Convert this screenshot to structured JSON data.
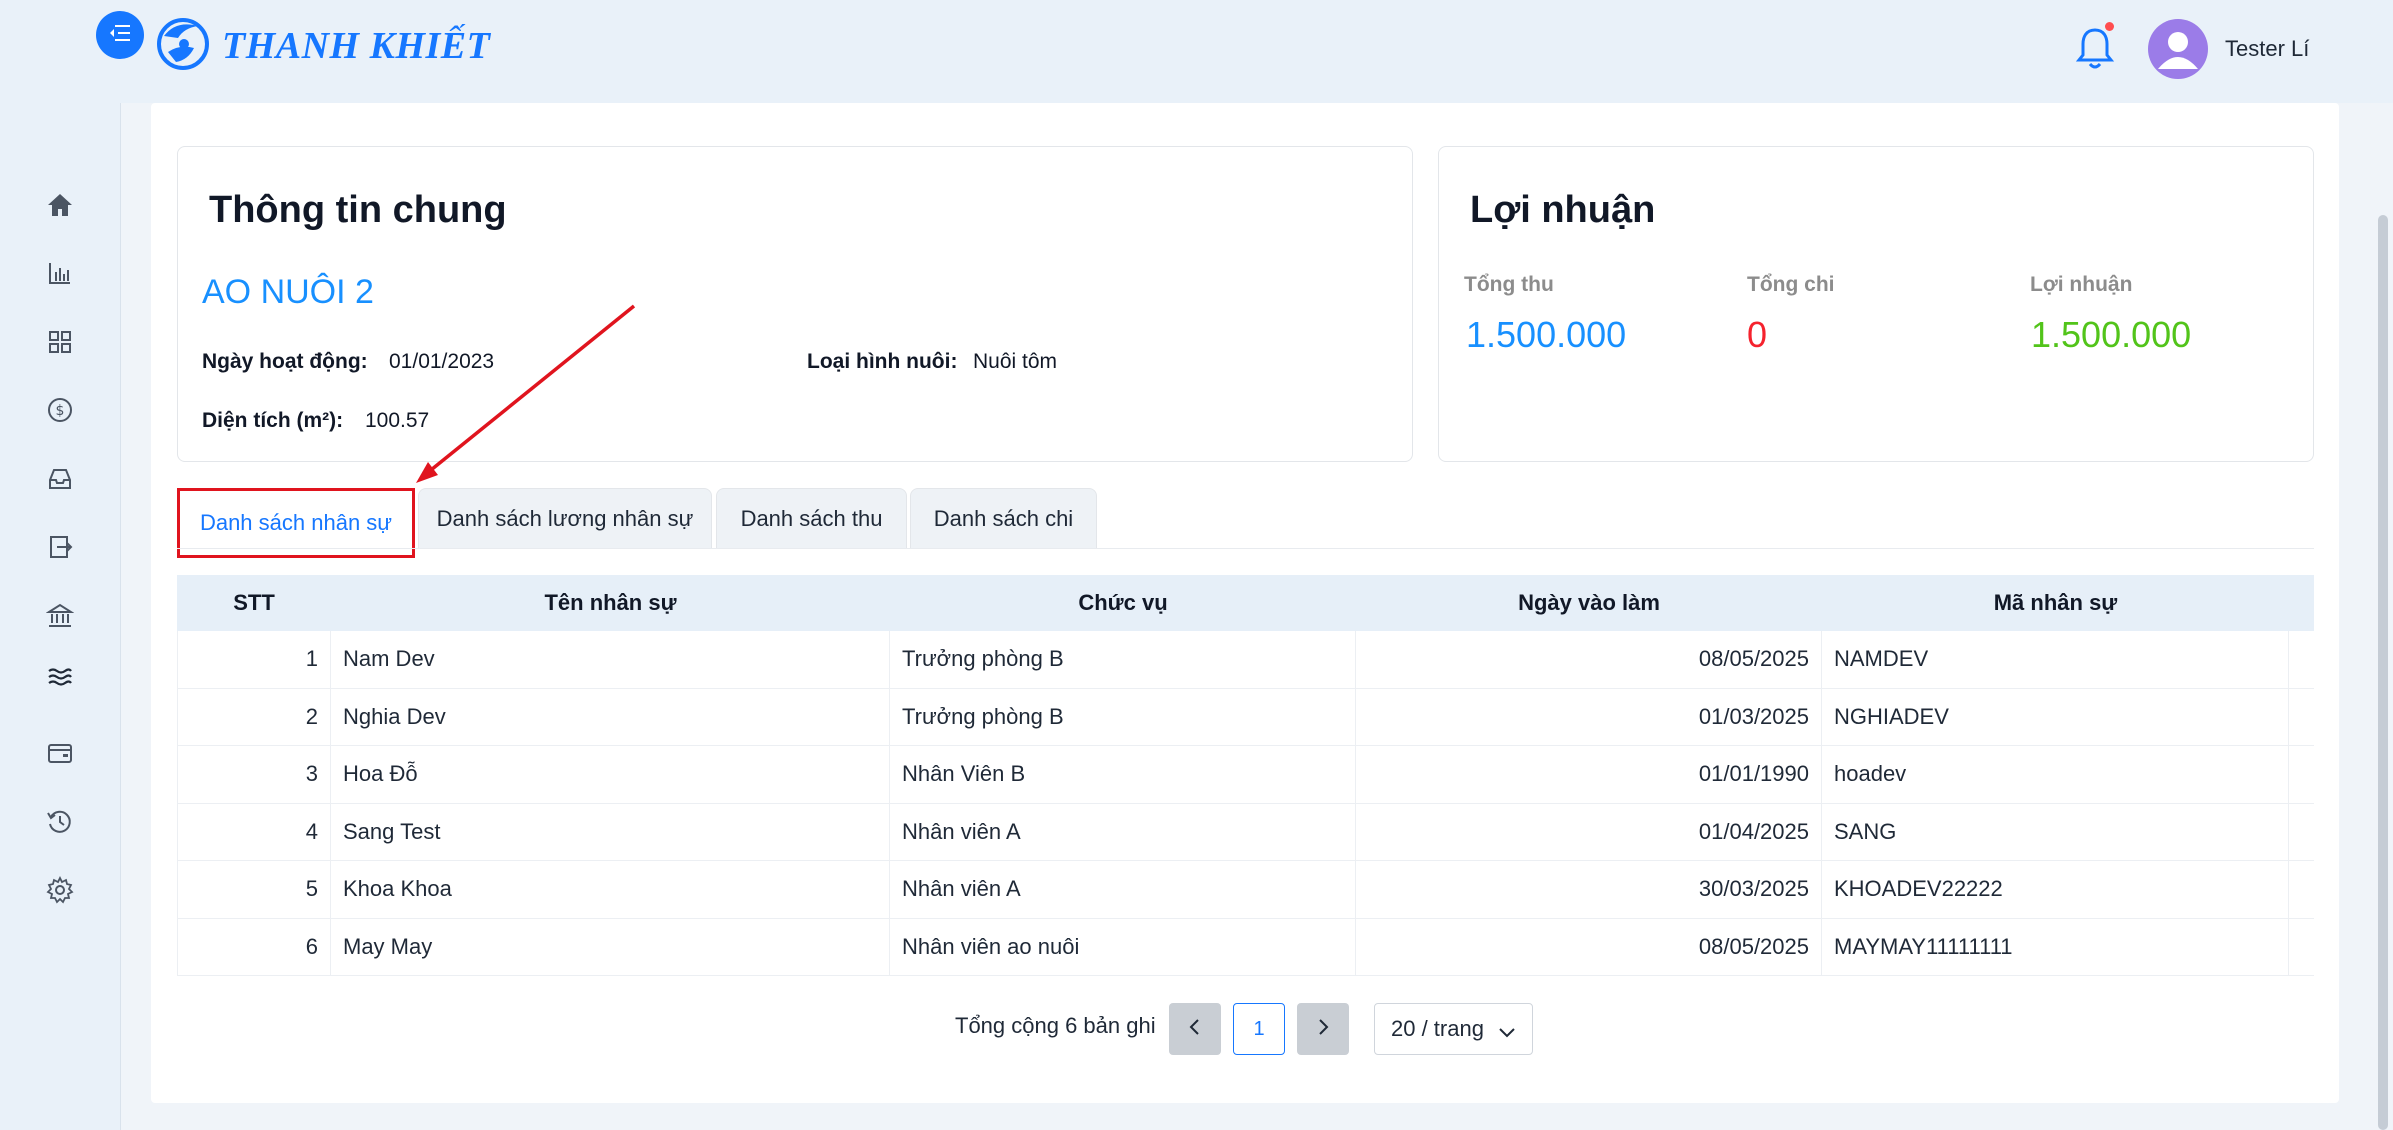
{
  "header": {
    "brand": "THANH KHIẾT",
    "user_name": "Tester Lí",
    "icons": [
      "menu-icon",
      "logo-icon",
      "bell-icon",
      "user-avatar-icon"
    ],
    "colors": {
      "primary": "#1677ff",
      "notification_dot": "#ff4d4f",
      "avatar": "#9b7ce8"
    }
  },
  "sidebar": {
    "items": [
      {
        "icon": "home-icon"
      },
      {
        "icon": "bar-chart-icon"
      },
      {
        "icon": "grid-icon"
      },
      {
        "icon": "dollar-icon"
      },
      {
        "icon": "inbox-icon"
      },
      {
        "icon": "import-icon"
      },
      {
        "icon": "bank-icon"
      },
      {
        "icon": "waves-icon"
      },
      {
        "icon": "wallet-icon"
      },
      {
        "icon": "history-icon"
      },
      {
        "icon": "settings-icon"
      }
    ]
  },
  "info_card": {
    "title": "Thông tin chung",
    "pond_name": "AO NUÔI 2",
    "fields": {
      "start_date_label": "Ngày hoạt động:",
      "start_date": "01/01/2023",
      "farming_type_label": "Loại hình nuôi:",
      "farming_type": "Nuôi tôm",
      "area_label": "Diện tích (m²):",
      "area": "100.57"
    }
  },
  "profit_card": {
    "title": "Lợi nhuận",
    "stats": [
      {
        "label": "Tổng thu",
        "value": "1.500.000",
        "color": "#1890ff"
      },
      {
        "label": "Tổng chi",
        "value": "0",
        "color": "#f5222d"
      },
      {
        "label": "Lợi nhuận",
        "value": "1.500.000",
        "color": "#52c41a"
      }
    ]
  },
  "tabs": [
    {
      "label": "Danh sách nhân sự",
      "active": true
    },
    {
      "label": "Danh sách lương nhân sự",
      "active": false
    },
    {
      "label": "Danh sách thu",
      "active": false
    },
    {
      "label": "Danh sách chi",
      "active": false
    }
  ],
  "table": {
    "columns": [
      "STT",
      "Tên nhân sự",
      "Chức vụ",
      "Ngày vào làm",
      "Mã nhân sự"
    ],
    "rows": [
      [
        "1",
        "Nam Dev",
        "Trưởng phòng B",
        "08/05/2025",
        "NAMDEV"
      ],
      [
        "2",
        "Nghia Dev",
        "Trưởng phòng B",
        "01/03/2025",
        "NGHIADEV"
      ],
      [
        "3",
        "Hoa Đỗ",
        "Nhân Viên B",
        "01/01/1990",
        "hoadev"
      ],
      [
        "4",
        "Sang Test",
        "Nhân viên A",
        "01/04/2025",
        "SANG"
      ],
      [
        "5",
        "Khoa Khoa",
        "Nhân viên A",
        "30/03/2025",
        "KHOADEV22222"
      ],
      [
        "6",
        "May May",
        "Nhân viên ao nuôi",
        "08/05/2025",
        "MAYMAY11111111"
      ]
    ]
  },
  "pagination": {
    "total_text": "Tổng cộng 6 bản ghi",
    "current_page": "1",
    "page_size": "20 / trang"
  },
  "annotation": {
    "highlight_color": "#e0141e"
  }
}
